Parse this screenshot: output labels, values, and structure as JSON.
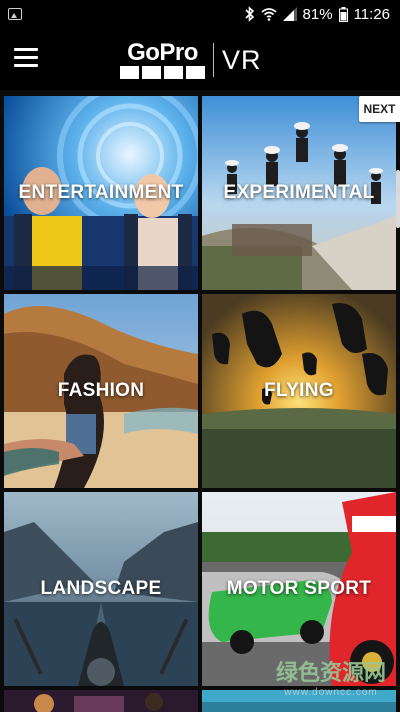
{
  "status_bar": {
    "battery": "81%",
    "time": "11:26"
  },
  "app_bar": {
    "logo_text": "GoPro",
    "logo_suffix": "VR"
  },
  "categories": [
    {
      "label": "ENTERTAINMENT"
    },
    {
      "label": "EXPERIMENTAL"
    },
    {
      "label": "FASHION"
    },
    {
      "label": "FLYING"
    },
    {
      "label": "LANDSCAPE"
    },
    {
      "label": "MOTOR SPORT"
    }
  ],
  "next_button": {
    "label": "NEXT"
  },
  "watermark": {
    "main": "绿色资源网",
    "sub": "www.downcc.com"
  }
}
